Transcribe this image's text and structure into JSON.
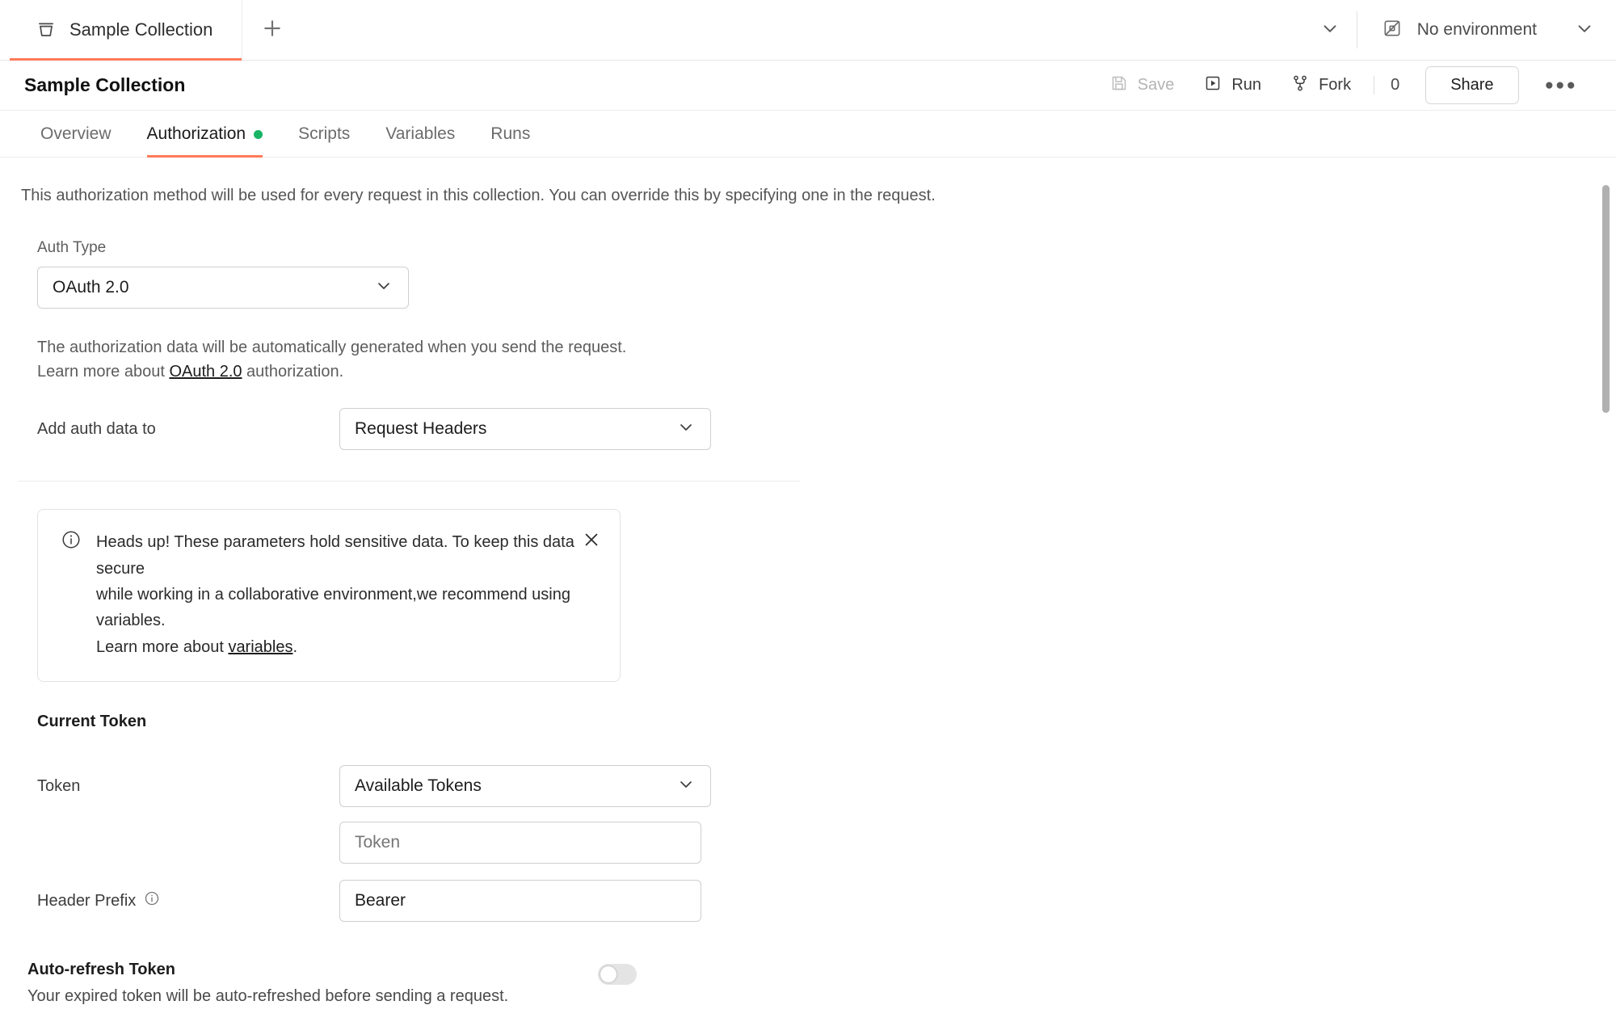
{
  "tabstrip": {
    "collection_tab": {
      "label": "Sample Collection",
      "icon": "collection-icon"
    },
    "new_tab_icon": "plus-icon",
    "tabs_chevron_icon": "chevron-down-icon",
    "environment": {
      "label": "No environment",
      "icon": "no-environment-icon",
      "chevron_icon": "chevron-down-icon"
    }
  },
  "header": {
    "title": "Sample Collection",
    "save_label": "Save",
    "save_icon": "save-disk-icon",
    "save_disabled": true,
    "run_label": "Run",
    "run_icon": "play-box-icon",
    "fork_label": "Fork",
    "fork_icon": "fork-branch-icon",
    "fork_count": "0",
    "share_label": "Share",
    "more_icon": "more-horizontal-icon"
  },
  "subtabs": [
    {
      "label": "Overview",
      "active": false,
      "dot": false
    },
    {
      "label": "Authorization",
      "active": true,
      "dot": true
    },
    {
      "label": "Scripts",
      "active": false,
      "dot": false
    },
    {
      "label": "Variables",
      "active": false,
      "dot": false
    },
    {
      "label": "Runs",
      "active": false,
      "dot": false
    }
  ],
  "main": {
    "description": "This authorization method will be used for every request in this collection. You can override this by specifying one in the request.",
    "auth_type": {
      "label": "Auth Type",
      "value": "OAuth 2.0",
      "chevron_icon": "chevron-down-icon"
    },
    "auth_help": {
      "line1": "The authorization data will be automatically generated when you send the request.",
      "line2_prefix": "Learn more about ",
      "line2_link": "OAuth 2.0",
      "line2_suffix": " authorization."
    },
    "add_auth_data_to": {
      "label": "Add auth data to",
      "value": "Request Headers",
      "chevron_icon": "chevron-down-icon"
    },
    "callout": {
      "icon": "info-circle-icon",
      "line1": "Heads up! These parameters hold sensitive data. To keep this data secure",
      "line2": "while working in a collaborative environment,we recommend using variables.",
      "line3_prefix": "Learn more about ",
      "line3_link": "variables",
      "line3_suffix": ".",
      "close_icon": "close-icon"
    },
    "current_token": {
      "section_title": "Current Token",
      "token_label": "Token",
      "token_select_value": "Available Tokens",
      "token_select_chevron_icon": "chevron-down-icon",
      "token_input_placeholder": "Token",
      "token_input_value": "",
      "header_prefix_label": "Header Prefix",
      "header_prefix_info_icon": "info-circle-icon",
      "header_prefix_value": "Bearer"
    },
    "auto_refresh": {
      "title": "Auto-refresh Token",
      "description": "Your expired token will be auto-refreshed before sending a request.",
      "enabled": false
    }
  },
  "colors": {
    "accent": "#ff7a59",
    "status_dot_green": "#18b566",
    "text_primary": "#1d1d1d",
    "text_muted": "#6b6b6b",
    "border": "#cfcfcf"
  }
}
